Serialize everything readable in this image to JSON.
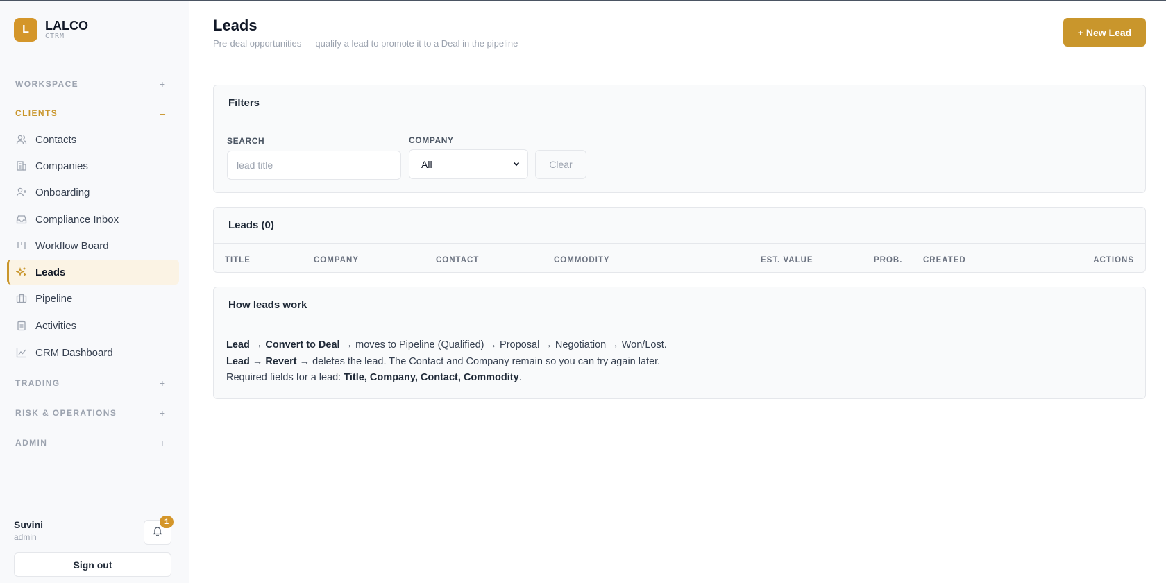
{
  "brand": {
    "logo_letter": "L",
    "name": "LALCO",
    "sub": "CTRM"
  },
  "sidebar": {
    "groups": {
      "workspace": {
        "label": "WORKSPACE",
        "toggle": "+"
      },
      "clients": {
        "label": "CLIENTS",
        "toggle": "–"
      },
      "trading": {
        "label": "TRADING",
        "toggle": "+"
      },
      "risk": {
        "label": "RISK & OPERATIONS",
        "toggle": "+"
      },
      "admin": {
        "label": "ADMIN",
        "toggle": "+"
      }
    },
    "items": [
      {
        "label": "Contacts",
        "icon": "users-icon"
      },
      {
        "label": "Companies",
        "icon": "building-icon"
      },
      {
        "label": "Onboarding",
        "icon": "user-plus-icon"
      },
      {
        "label": "Compliance Inbox",
        "icon": "inbox-icon"
      },
      {
        "label": "Workflow Board",
        "icon": "kanban-icon"
      },
      {
        "label": "Leads",
        "icon": "sparkles-icon",
        "active": true
      },
      {
        "label": "Pipeline",
        "icon": "briefcase-icon"
      },
      {
        "label": "Activities",
        "icon": "clipboard-icon"
      },
      {
        "label": "CRM Dashboard",
        "icon": "line-chart-icon"
      }
    ],
    "user": {
      "name": "Suvini",
      "role": "admin"
    },
    "notifications": {
      "count": "1"
    },
    "signout_label": "Sign out"
  },
  "header": {
    "title": "Leads",
    "subtitle": "Pre-deal opportunities — qualify a lead to promote it to a Deal in the pipeline",
    "new_lead_label": "+ New Lead"
  },
  "filters": {
    "title": "Filters",
    "search_label": "SEARCH",
    "search_placeholder": "lead title",
    "search_value": "",
    "company_label": "COMPANY",
    "company_selected": "All",
    "clear_label": "Clear"
  },
  "leads_table": {
    "title": "Leads (0)",
    "columns": [
      "TITLE",
      "COMPANY",
      "CONTACT",
      "COMMODITY",
      "EST. VALUE",
      "PROB.",
      "CREATED",
      "ACTIONS"
    ],
    "rows": []
  },
  "howto": {
    "title": "How leads work",
    "line1": {
      "a": "Lead",
      "arrow1": " → ",
      "b": "Convert to Deal",
      "rest": " → moves to Pipeline (Qualified) → Proposal → Negotiation → Won/Lost."
    },
    "line2": {
      "a": "Lead",
      "arrow1": " → ",
      "b": "Revert",
      "rest": " → deletes the lead. The Contact and Company remain so you can try again later."
    },
    "line3": {
      "prefix": "Required fields for a lead: ",
      "fields": "Title, Company, Contact, Commodity",
      "suffix": "."
    }
  },
  "colors": {
    "accent": "#c9962c",
    "accent_bg": "#fbf3e4",
    "border": "#e5e7eb"
  }
}
